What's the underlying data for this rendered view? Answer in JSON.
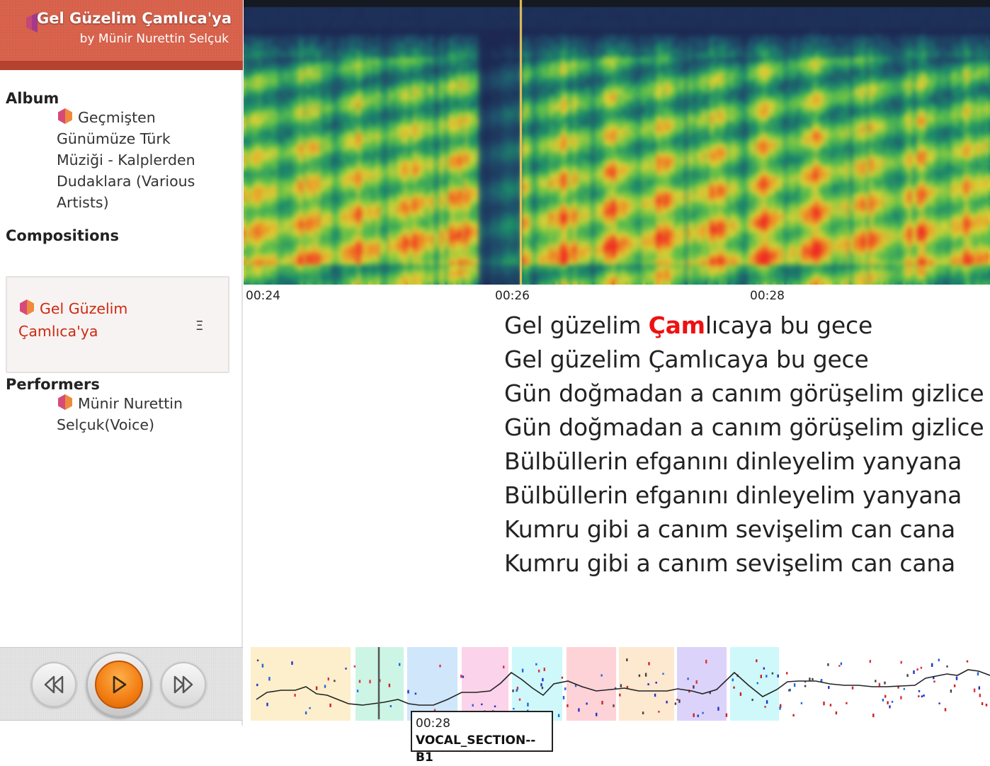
{
  "header": {
    "title": "Gel Güzelim Çamlıca'ya",
    "artist": "by Münir Nurettin Selçuk"
  },
  "album": {
    "heading": "Album",
    "name": "Geçmişten Günümüze Türk Müziği - Kalplerden Dudaklara (Various Artists)"
  },
  "compositions": {
    "heading": "Compositions",
    "items": [
      {
        "label": "Gel Güzelim Çamlıca'ya",
        "menu_icon": "Ξ"
      }
    ]
  },
  "performers": {
    "heading": "Performers",
    "items": [
      {
        "label": "Münir Nurettin Selçuk(Voice)"
      }
    ]
  },
  "controls": {
    "rewind_icon": "rewind-icon",
    "play_icon": "play-icon",
    "forward_icon": "fast-forward-icon"
  },
  "spectrogram": {
    "time_labels": [
      "00:24",
      "00:26",
      "00:28"
    ],
    "cursor_time": "00:26",
    "colormap": [
      "#1c2852",
      "#1f4f6c",
      "#1c8c6a",
      "#5cc04a",
      "#d9d335",
      "#f08a25",
      "#ee2b22"
    ]
  },
  "lyrics": {
    "current_line": {
      "before": "Gel güzelim ",
      "highlight": "Çam",
      "after": "lıcaya bu gece"
    },
    "lines": [
      "Gel güzelim Çamlıcaya bu gece",
      "Gün doğmadan a canım görüşelim gizlice",
      "Gün doğmadan a canım görüşelim gizlice",
      "Bülbüllerin efganını dinleyelim yanyana",
      "Bülbüllerin efganını dinleyelim yanyana",
      "Kumru gibi a canım sevişelim can cana",
      "Kumru gibi a canım sevişelim can cana"
    ],
    "highlight_color": "#ee1111"
  },
  "timeline": {
    "section_colors": [
      "#fdefcc",
      "#cdf5e6",
      "#cfe6fb",
      "#fbd3ea",
      "#cff8fa",
      "#fdd3d7",
      "#fde8d0",
      "#dcd3fb",
      "#cff8fa"
    ]
  },
  "tooltip": {
    "time": "00:28",
    "section": "VOCAL_SECTION--B1"
  }
}
